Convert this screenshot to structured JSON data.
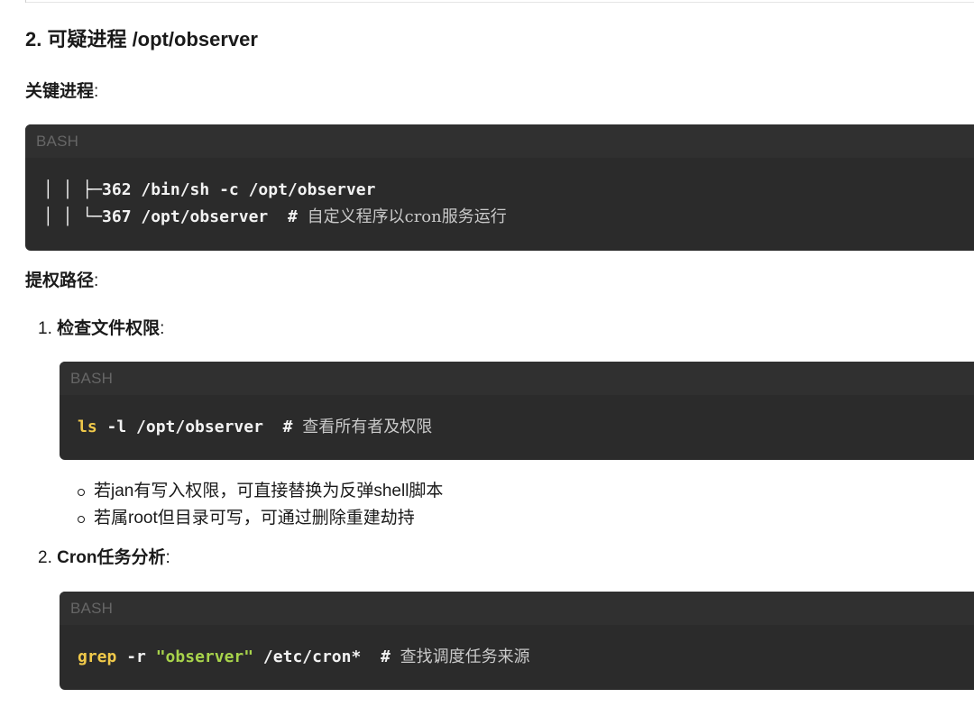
{
  "section": {
    "title": "2. 可疑进程 /opt/observer"
  },
  "key_process": {
    "label": "关键进程",
    "colon": ":",
    "code": {
      "lang": "BASH",
      "line1": "│ │ ├─362 /bin/sh -c /opt/observer",
      "line2_code": "│ │ └─367 /opt/observer  ",
      "line2_hash": "# ",
      "line2_comment": "自定义程序以cron服务运行"
    }
  },
  "escalation": {
    "label": "提权路径",
    "colon": ":",
    "steps": [
      {
        "number": "1.",
        "title": "检查文件权限",
        "colon": ":",
        "code": {
          "lang": "BASH",
          "cmd": "ls",
          "rest": " -l /opt/observer  ",
          "hash": "# ",
          "comment": "查看所有者及权限"
        },
        "bullets": [
          "若jan有写入权限，可直接替换为反弹shell脚本",
          "若属root但目录可写，可通过删除重建劫持"
        ]
      },
      {
        "number": "2.",
        "title": "Cron任务分析",
        "colon": ":",
        "code": {
          "lang": "BASH",
          "cmd": "grep",
          "flag": " -r ",
          "str": "\"observer\"",
          "rest": " /etc/cron*  ",
          "hash": "# ",
          "comment": "查找调度任务来源"
        }
      }
    ]
  }
}
